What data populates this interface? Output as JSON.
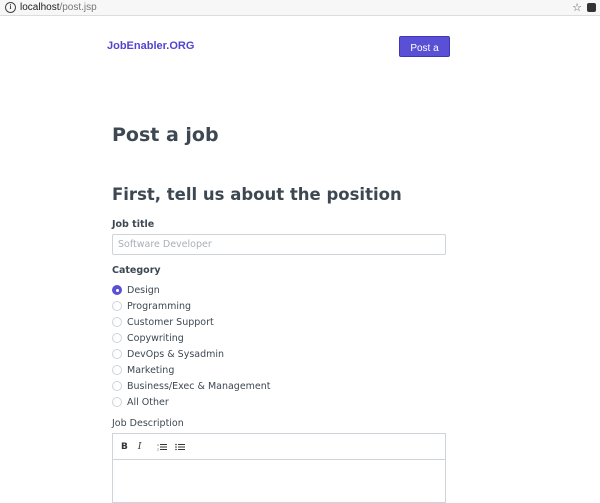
{
  "browser": {
    "url_host": "localhost",
    "url_path": "/post.jsp"
  },
  "header": {
    "brand": "JobEnabler.ORG",
    "post_job_button": "Post a job"
  },
  "page": {
    "title": "Post a job",
    "section_title": "First, tell us about the position"
  },
  "form": {
    "job_title_label": "Job title",
    "job_title_placeholder": "Software Developer",
    "category_label": "Category",
    "categories": [
      {
        "label": "Design",
        "selected": true
      },
      {
        "label": "Programming",
        "selected": false
      },
      {
        "label": "Customer Support",
        "selected": false
      },
      {
        "label": "Copywriting",
        "selected": false
      },
      {
        "label": "DevOps & Sysadmin",
        "selected": false
      },
      {
        "label": "Marketing",
        "selected": false
      },
      {
        "label": "Business/Exec & Management",
        "selected": false
      },
      {
        "label": "All Other",
        "selected": false
      }
    ],
    "description_label": "Job Description",
    "editor_toolbar": {
      "bold": "B",
      "italic": "I"
    }
  },
  "colors": {
    "accent": "#5a50d6",
    "text": "#3d4852"
  }
}
